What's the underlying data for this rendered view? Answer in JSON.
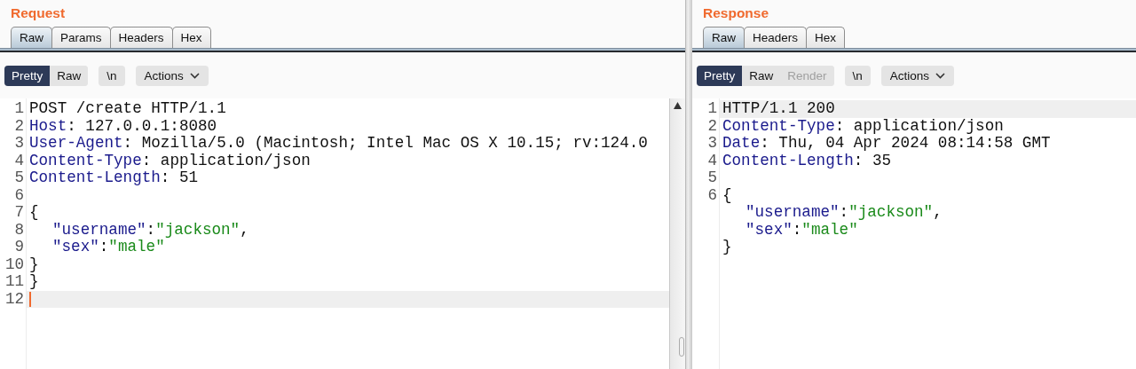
{
  "request": {
    "title": "Request",
    "tabs": [
      {
        "label": "Raw",
        "selected": true
      },
      {
        "label": "Params",
        "selected": false
      },
      {
        "label": "Headers",
        "selected": false
      },
      {
        "label": "Hex",
        "selected": false
      }
    ],
    "view_buttons": [
      {
        "label": "Pretty",
        "selected": true,
        "disabled": false
      },
      {
        "label": "Raw",
        "selected": false,
        "disabled": false
      }
    ],
    "newline_button": "\\n",
    "actions_button": "Actions",
    "lines": [
      {
        "number": "1",
        "current": false,
        "tokens": [
          {
            "kind": "text",
            "text": "POST /create HTTP/1.1"
          }
        ]
      },
      {
        "number": "2",
        "current": false,
        "tokens": [
          {
            "kind": "name",
            "text": "Host"
          },
          {
            "kind": "text",
            "text": ": 127.0.0.1:8080"
          }
        ]
      },
      {
        "number": "3",
        "current": false,
        "tokens": [
          {
            "kind": "name",
            "text": "User-Agent"
          },
          {
            "kind": "text",
            "text": ": Mozilla/5.0 (Macintosh; Intel Mac OS X 10.15; rv:124.0"
          }
        ]
      },
      {
        "number": "4",
        "current": false,
        "tokens": [
          {
            "kind": "name",
            "text": "Content-Type"
          },
          {
            "kind": "text",
            "text": ": application/json"
          }
        ]
      },
      {
        "number": "5",
        "current": false,
        "tokens": [
          {
            "kind": "name",
            "text": "Content-Length"
          },
          {
            "kind": "text",
            "text": ": 51"
          }
        ]
      },
      {
        "number": "6",
        "current": false
      },
      {
        "number": "7",
        "current": false,
        "tokens": [
          {
            "kind": "text",
            "text": "{"
          }
        ],
        "children": [
          {
            "number": "8",
            "current": false,
            "tokens": [
              {
                "kind": "name",
                "text": "\"username\""
              },
              {
                "kind": "text",
                "text": ":"
              },
              {
                "kind": "string",
                "text": "\"jackson\""
              },
              {
                "kind": "text",
                "text": ","
              }
            ]
          },
          {
            "number": "9",
            "current": false,
            "tokens": [
              {
                "kind": "name",
                "text": "\"sex\""
              },
              {
                "kind": "text",
                "text": ":"
              },
              {
                "kind": "string",
                "text": "\"male\""
              }
            ]
          }
        ]
      },
      {
        "number": "10",
        "current": false,
        "tokens": [
          {
            "kind": "text",
            "text": "}"
          }
        ]
      },
      {
        "number": "11",
        "current": false,
        "tokens": [
          {
            "kind": "text",
            "text": "}"
          }
        ]
      },
      {
        "number": "12",
        "current": true
      }
    ]
  },
  "response": {
    "title": "Response",
    "tabs": [
      {
        "label": "Raw",
        "selected": true
      },
      {
        "label": "Headers",
        "selected": false
      },
      {
        "label": "Hex",
        "selected": false
      }
    ],
    "view_buttons": [
      {
        "label": "Pretty",
        "selected": true,
        "disabled": false
      },
      {
        "label": "Raw",
        "selected": false,
        "disabled": false
      },
      {
        "label": "Render",
        "selected": false,
        "disabled": true
      }
    ],
    "newline_button": "\\n",
    "actions_button": "Actions",
    "lines": [
      {
        "number": "1",
        "current": true,
        "tokens": [
          {
            "kind": "text",
            "text": "HTTP/1.1 200"
          }
        ]
      },
      {
        "number": "2",
        "current": false,
        "tokens": [
          {
            "kind": "name",
            "text": "Content-Type"
          },
          {
            "kind": "text",
            "text": ": application/json"
          }
        ]
      },
      {
        "number": "3",
        "current": false,
        "tokens": [
          {
            "kind": "name",
            "text": "Date"
          },
          {
            "kind": "text",
            "text": ": Thu, 04 Apr 2024 08:14:58 GMT"
          }
        ]
      },
      {
        "number": "4",
        "current": false,
        "tokens": [
          {
            "kind": "name",
            "text": "Content-Length"
          },
          {
            "kind": "text",
            "text": ": 35"
          }
        ]
      },
      {
        "number": "5",
        "current": false
      },
      {
        "number": "6",
        "current": false,
        "tokens": [
          {
            "kind": "text",
            "text": "{"
          }
        ],
        "children": [
          {
            "current": false,
            "tokens": [
              {
                "kind": "name",
                "text": "\"username\""
              },
              {
                "kind": "text",
                "text": ":"
              },
              {
                "kind": "string",
                "text": "\"jackson\""
              },
              {
                "kind": "text",
                "text": ","
              }
            ]
          },
          {
            "current": false,
            "tokens": [
              {
                "kind": "name",
                "text": "\"sex\""
              },
              {
                "kind": "text",
                "text": ":"
              },
              {
                "kind": "string",
                "text": "\"male\""
              }
            ]
          }
        ]
      },
      {
        "current": false,
        "tokens": [
          {
            "kind": "text",
            "text": "}"
          }
        ]
      }
    ]
  }
}
